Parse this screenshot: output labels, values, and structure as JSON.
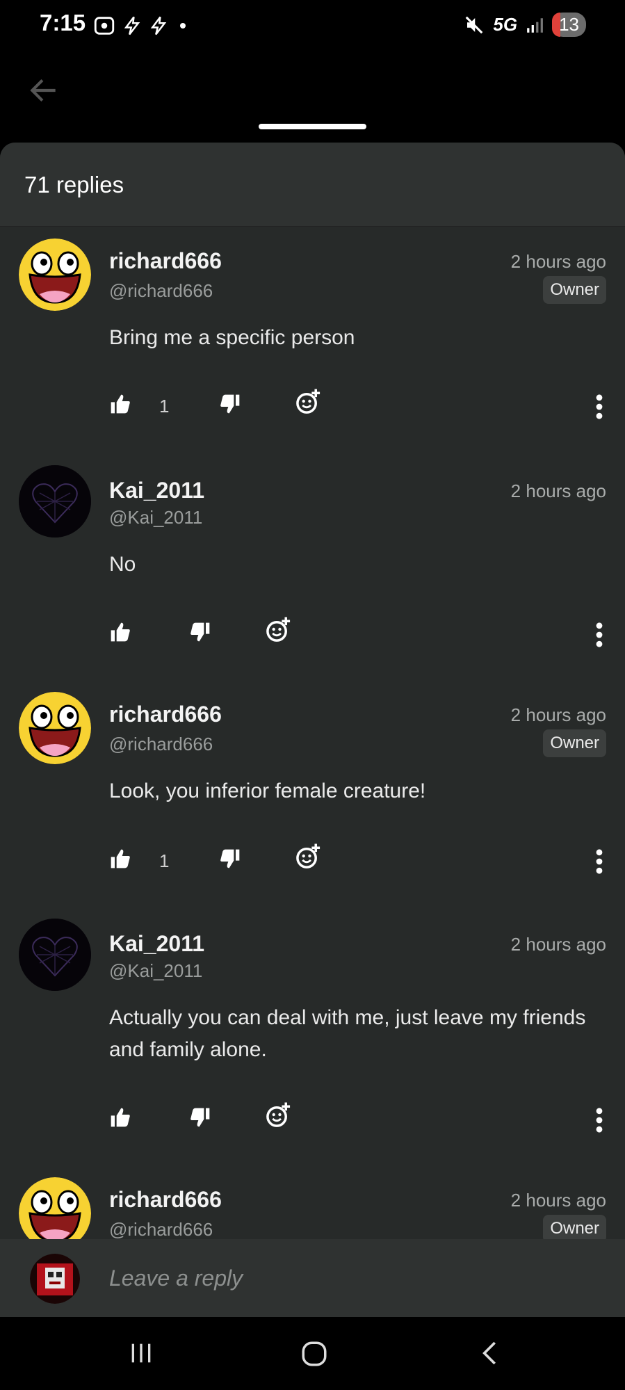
{
  "status_bar": {
    "time": "7:15",
    "network": "5G",
    "battery": "13"
  },
  "sheet": {
    "title": "71 replies"
  },
  "comments": [
    {
      "username": "richard666",
      "handle": "@richard666",
      "time": "2 hours ago",
      "badge": "Owner",
      "text": "Bring me a specific person",
      "likes": "1"
    },
    {
      "username": "Kai_2011",
      "handle": "@Kai_2011",
      "time": "2 hours ago",
      "text": "No"
    },
    {
      "username": "richard666",
      "handle": "@richard666",
      "time": "2 hours ago",
      "badge": "Owner",
      "text": "Look, you inferior female creature!",
      "likes": "1"
    },
    {
      "username": "Kai_2011",
      "handle": "@Kai_2011",
      "time": "2 hours ago",
      "text": "Actually you can deal with me, just leave my friends and family alone."
    },
    {
      "username": "richard666",
      "handle": "@richard666",
      "time": "2 hours ago",
      "badge": "Owner"
    }
  ],
  "reply_bar": {
    "placeholder": "Leave a reply"
  },
  "colors": {
    "background": "#272a29",
    "header": "#2f3231",
    "accent_avatar": "#f7d232"
  },
  "icons": [
    "back-arrow-icon",
    "thumbs-up-icon",
    "thumbs-down-icon",
    "emoji-add-icon",
    "more-vert-icon",
    "recent-apps-icon",
    "home-icon",
    "nav-back-icon"
  ]
}
